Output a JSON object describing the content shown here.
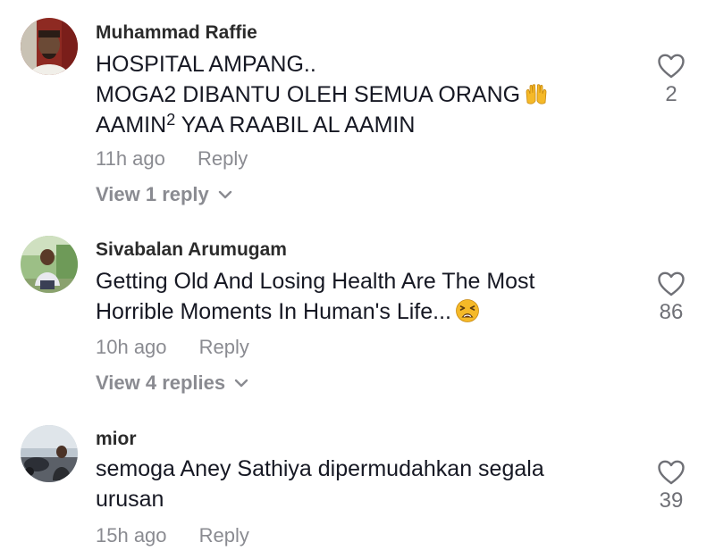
{
  "comments": [
    {
      "username": "Muhammad Raffie",
      "lines": [
        "HOSPITAL AMPANG..",
        "MOGA2 DIBANTU OLEH SEMUA ORANG",
        "AAMIN",
        "2",
        " YAA RAABIL AL AAMIN"
      ],
      "time": "11h ago",
      "reply_label": "Reply",
      "view_replies": "View 1 reply",
      "likes": "2",
      "emoji": "raised-hands-emoji"
    },
    {
      "username": "Sivabalan Arumugam",
      "lines": [
        "Getting Old And Losing Health Are The Most",
        "Horrible Moments In Human's Life..."
      ],
      "time": "10h ago",
      "reply_label": "Reply",
      "view_replies": "View 4 replies",
      "likes": "86",
      "emoji": "weary-face-emoji"
    },
    {
      "username": "mior",
      "lines": [
        "semoga Aney Sathiya dipermudahkan segala",
        "urusan"
      ],
      "time": "15h ago",
      "reply_label": "Reply",
      "likes": "39"
    }
  ],
  "icons": {
    "like": "heart-outline-icon",
    "expand": "chevron-down-icon"
  },
  "colors": {
    "text": "#161823",
    "secondary": "#8a8b91",
    "count": "#6f7076",
    "emoji": "#f5b928"
  }
}
